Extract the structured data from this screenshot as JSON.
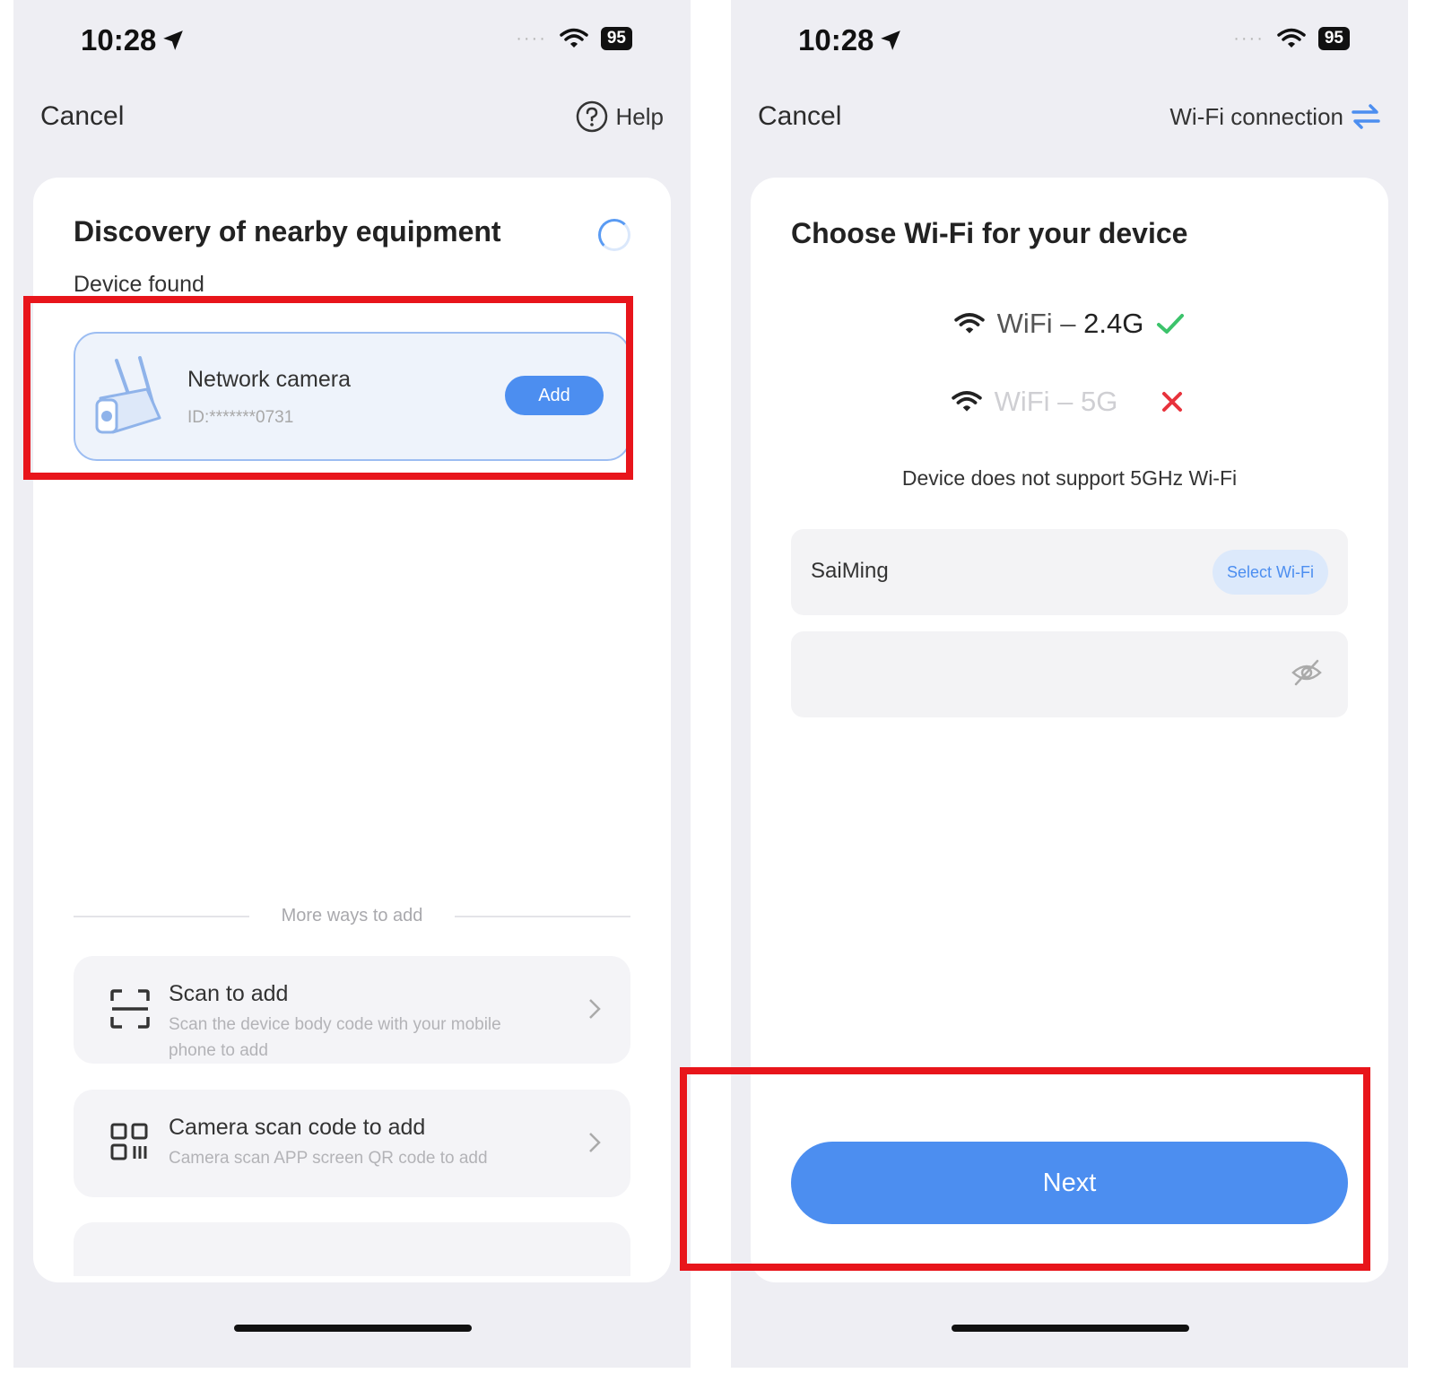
{
  "left_screen": {
    "status_bar": {
      "time": "10:28",
      "battery": "95"
    },
    "nav": {
      "cancel_label": "Cancel",
      "help_label": "Help"
    },
    "title": "Discovery of nearby equipment",
    "device_found_label": "Device found",
    "device": {
      "name": "Network camera",
      "id": "ID:*******0731",
      "add_label": "Add"
    },
    "more_ways_label": "More ways to add",
    "options": [
      {
        "title": "Scan to add",
        "description": "Scan the device body code with your mobile phone to add",
        "icon": "scan-frame-icon"
      },
      {
        "title": "Camera scan code to add",
        "description": "Camera scan APP screen QR code to add",
        "icon": "qr-code-icon"
      }
    ]
  },
  "right_screen": {
    "status_bar": {
      "time": "10:28",
      "battery": "95"
    },
    "nav": {
      "cancel_label": "Cancel",
      "mode_label": "Wi-Fi connection"
    },
    "title": "Choose Wi-Fi for your device",
    "bands": [
      {
        "prefix": "WiFi – ",
        "band": "2.4G",
        "status": "supported"
      },
      {
        "prefix": "WiFi – ",
        "band": "5G",
        "status": "unsupported"
      }
    ],
    "support_note": "Device does not support 5GHz Wi-Fi",
    "ssid": {
      "value": "SaiMing",
      "select_label": "Select Wi-Fi"
    },
    "password": {
      "value": "",
      "placeholder": ""
    },
    "next_label": "Next"
  },
  "colors": {
    "accent": "#4c8ef0",
    "highlight": "#e8151b",
    "success": "#3cc36b",
    "error": "#e8323c",
    "background": "#eeeef3"
  }
}
